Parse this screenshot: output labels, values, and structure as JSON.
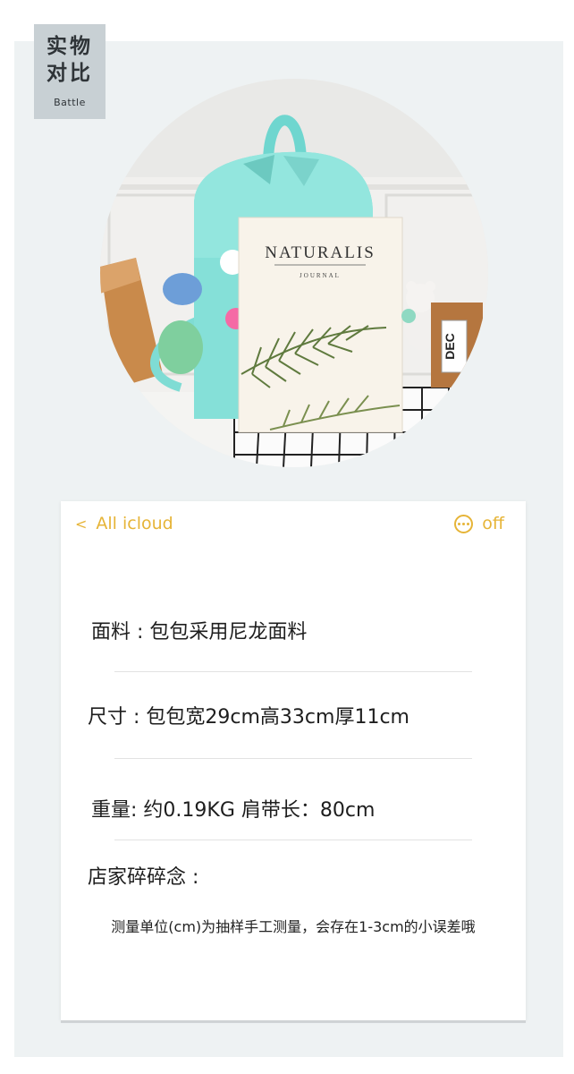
{
  "badge": {
    "line1": "实物",
    "line2": "对比",
    "line3": "Battle"
  },
  "photo": {
    "book_title": "NATURALIS",
    "book_subtitle": "JOURNAL",
    "tag_text": "DEC"
  },
  "notes_header": {
    "back_label": "All icloud",
    "right_label": "off",
    "accent_color": "#e6b437",
    "back_icon": "chevron-left-icon",
    "more_icon": "ellipsis-circle-icon"
  },
  "specs": {
    "material": {
      "label": "面料",
      "value": " : 包包采用尼龙面料"
    },
    "size": {
      "label": "尺寸",
      "value": " : 包包宽29cm高33cm厚11cm"
    },
    "weight": {
      "label": "重量:",
      "value": "  约0.19KG   肩带长：80cm"
    },
    "notes_title": {
      "label": "店家碎碎念",
      "value": " :"
    },
    "disclaimer": "测量单位(cm)为抽样手工测量，会存在1-3cm的小误差哦"
  }
}
